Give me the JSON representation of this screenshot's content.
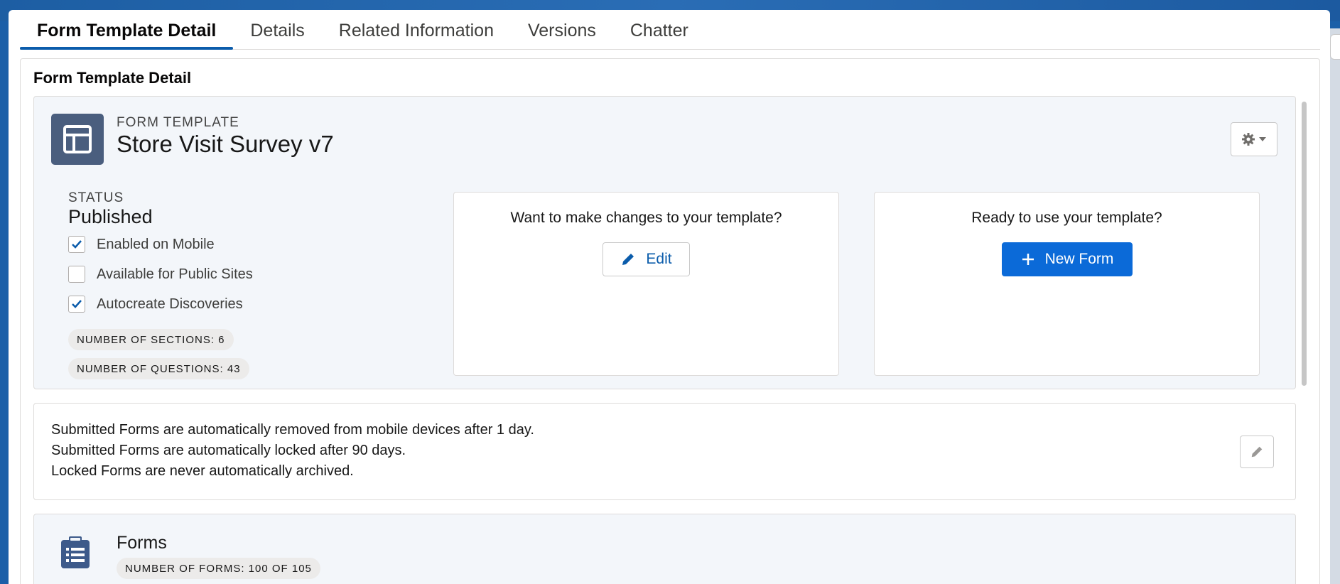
{
  "tabs": [
    {
      "label": "Form Template Detail",
      "active": true
    },
    {
      "label": "Details",
      "active": false
    },
    {
      "label": "Related Information",
      "active": false
    },
    {
      "label": "Versions",
      "active": false
    },
    {
      "label": "Chatter",
      "active": false
    }
  ],
  "section": {
    "title": "Form Template Detail"
  },
  "record": {
    "entity_label": "FORM TEMPLATE",
    "name": "Store Visit Survey v7",
    "icon": "form-template-icon"
  },
  "status": {
    "label": "STATUS",
    "value": "Published"
  },
  "checkboxes": [
    {
      "label": "Enabled on Mobile",
      "checked": true
    },
    {
      "label": "Available for Public Sites",
      "checked": false
    },
    {
      "label": "Autocreate Discoveries",
      "checked": true
    }
  ],
  "counts": {
    "sections": "NUMBER OF SECTIONS: 6",
    "questions": "NUMBER OF QUESTIONS: 43"
  },
  "edit_cta": {
    "prompt": "Want to make changes to your template?",
    "button_label": "Edit"
  },
  "use_cta": {
    "prompt": "Ready to use your template?",
    "button_label": "New Form"
  },
  "info": {
    "lines": [
      "Submitted Forms are automatically removed from mobile devices after 1 day.",
      "Submitted Forms are automatically locked after 90 days.",
      "Locked Forms are never automatically archived."
    ]
  },
  "forms": {
    "title": "Forms",
    "count": "NUMBER OF FORMS: 100 OF 105"
  },
  "colors": {
    "brand": "#0b5cab",
    "primary_button": "#0b6ad8",
    "icon_bg": "#4a5e7e",
    "card_bg": "#f3f6fa"
  }
}
